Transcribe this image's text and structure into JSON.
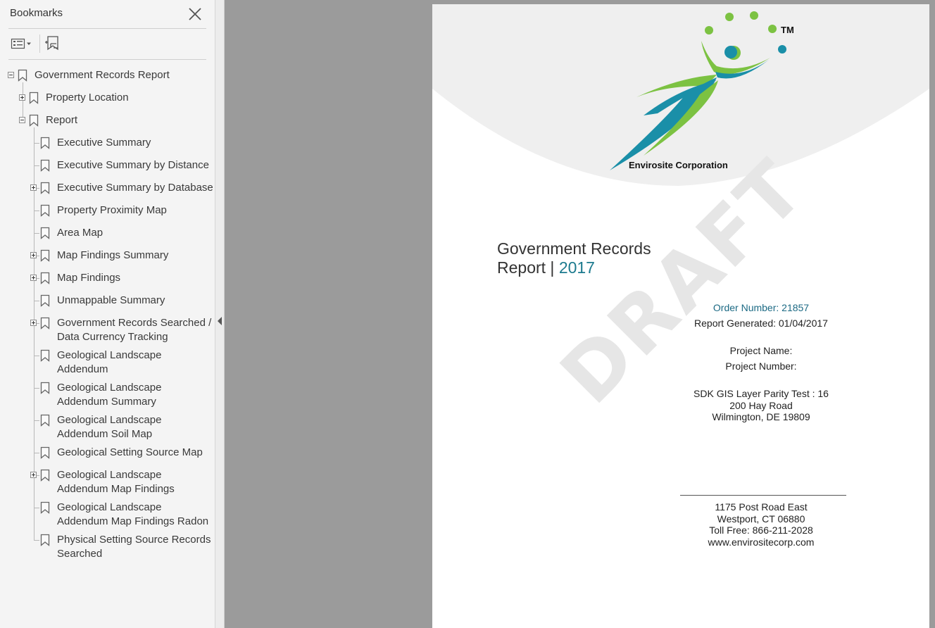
{
  "bookmarks_panel": {
    "title": "Bookmarks",
    "close_icon": "close-icon",
    "options_icon": "options-menu-icon",
    "new_bookmark_icon": "new-bookmark-icon",
    "items": [
      {
        "label": "Government Records Report",
        "expanded": true
      },
      {
        "label": "Property Location",
        "expanded": false
      },
      {
        "label": "Report",
        "expanded": true
      },
      {
        "label": "Executive Summary"
      },
      {
        "label": "Executive Summary by Distance"
      },
      {
        "label": "Executive Summary by Database",
        "expanded": false
      },
      {
        "label": "Property Proximity Map"
      },
      {
        "label": "Area Map"
      },
      {
        "label": "Map Findings Summary",
        "expanded": false
      },
      {
        "label": "Map Findings",
        "expanded": false
      },
      {
        "label": "Unmappable Summary"
      },
      {
        "label": "Government Records Searched /",
        "label2": "Data Currency Tracking",
        "expanded": false
      },
      {
        "label": "Geological Landscape",
        "label2": "Addendum"
      },
      {
        "label": "Geological Landscape",
        "label2": "Addendum Summary"
      },
      {
        "label": "Geological Landscape",
        "label2": "Addendum Soil Map"
      },
      {
        "label": "Geological Setting Source Map"
      },
      {
        "label": "Geological Landscape",
        "label2": "Addendum Map Findings",
        "expanded": false
      },
      {
        "label": "Geological Landscape",
        "label2": "Addendum Map Findings Radon"
      },
      {
        "label": "Physical Setting Source Records",
        "label2": "Searched"
      }
    ]
  },
  "document": {
    "logo": {
      "company": "Envirosite Corporation",
      "tm": "TM",
      "colors": {
        "green": "#7cc242",
        "teal": "#1a8fa8"
      }
    },
    "watermark": "DRAFT",
    "title_line1": "Government Records",
    "title_line2": "Report",
    "title_sep": " | ",
    "title_year": "2017",
    "order_number": "Order Number: 21857",
    "report_generated": "Report Generated: 01/04/2017",
    "project_name": "Project Name:",
    "project_number": "Project Number:",
    "site_line1": "SDK GIS Layer Parity Test : 16",
    "site_line2": "200 Hay Road",
    "site_line3": "Wilmington, DE 19809",
    "footer_line1": "1175 Post Road East",
    "footer_line2": "Westport, CT 06880",
    "footer_line3": "Toll Free: 866-211-2028",
    "footer_line4": "www.envirositecorp.com"
  }
}
